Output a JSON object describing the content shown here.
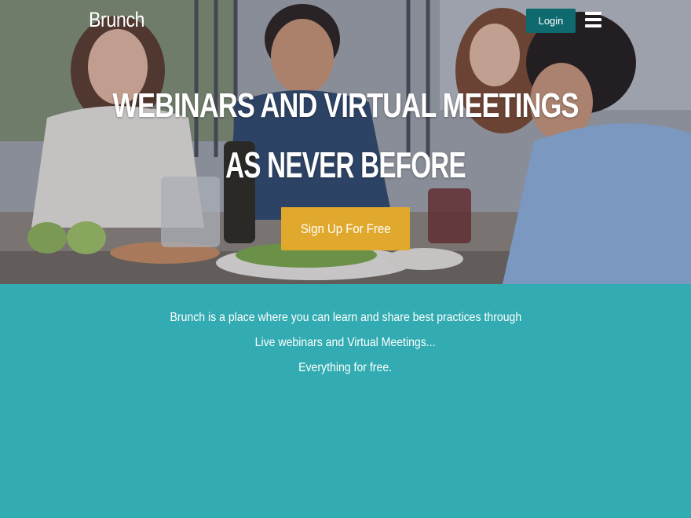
{
  "header": {
    "brand": "Brunch",
    "login_label": "Login",
    "menu_icon": "hamburger-menu-icon"
  },
  "hero": {
    "headline": "WEBINARS AND VIRTUAL MEETINGS",
    "subheadline": "AS NEVER BEFORE",
    "cta_label": "Sign Up For Free",
    "cta_color": "#e0a92d"
  },
  "intro": {
    "lines": [
      "Brunch is a place where you can learn and share best practices through",
      "Live webinars and Virtual Meetings...",
      "Everything for free."
    ]
  },
  "colors": {
    "teal_background": "#32acb2",
    "login_button": "#0f6a70"
  }
}
